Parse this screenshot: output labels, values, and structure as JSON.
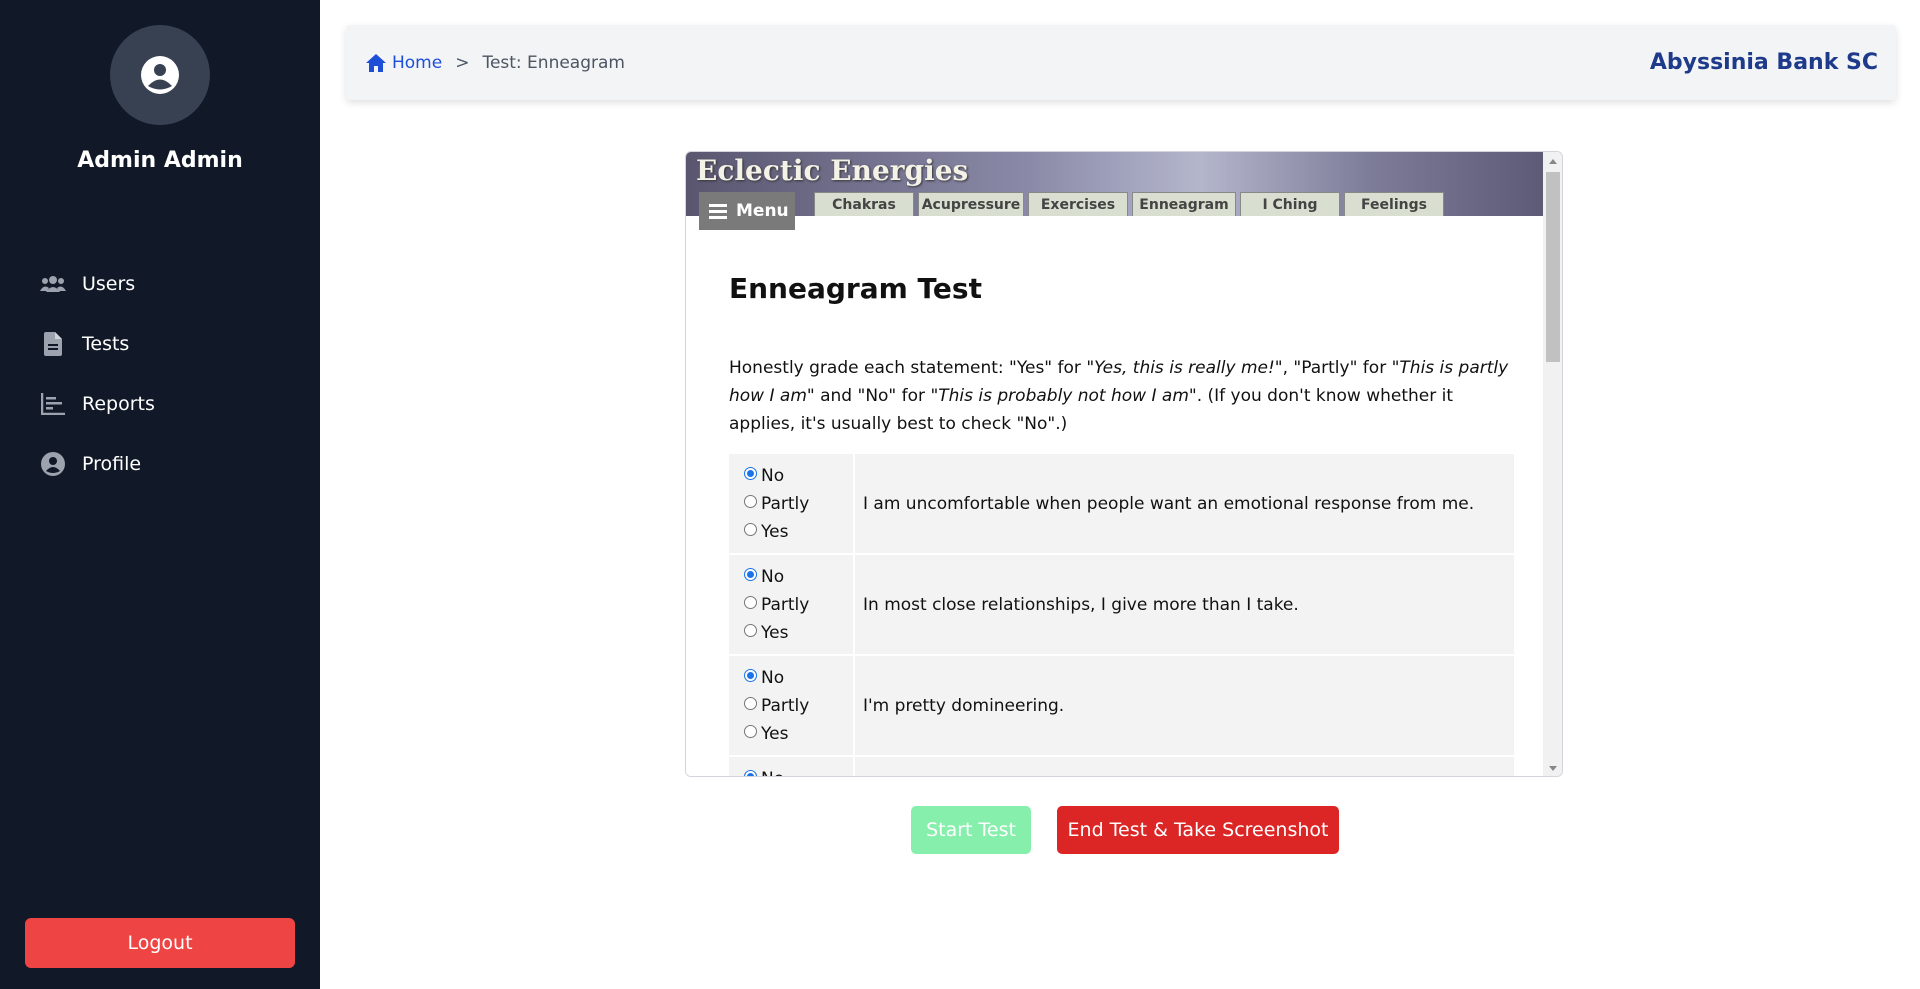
{
  "sidebar": {
    "user_name": "Admin Admin",
    "items": [
      {
        "label": "Users",
        "icon": "users-icon"
      },
      {
        "label": "Tests",
        "icon": "document-icon"
      },
      {
        "label": "Reports",
        "icon": "chart-icon"
      },
      {
        "label": "Profile",
        "icon": "user-circle-icon"
      }
    ],
    "logout_label": "Logout"
  },
  "header": {
    "breadcrumb": {
      "home": "Home",
      "separator": ">",
      "current": "Test: Enneagram"
    },
    "brand": "Abyssinia Bank SC"
  },
  "frame": {
    "site_title": "Eclectic Energies",
    "menu_label": "Menu",
    "tabs": [
      "Chakras",
      "Acupressure",
      "Exercises",
      "Enneagram",
      "I Ching",
      "Feelings"
    ],
    "heading": "Enneagram Test",
    "intro": {
      "p1": "Honestly grade each statement: \"Yes\" for ",
      "e1": "\"Yes, this is really me!\"",
      "p2": ", \"Partly\" for ",
      "e2": "\"This is partly how I am\"",
      "p3": " and \"No\" for ",
      "e3": "\"This is probably not how I am\"",
      "p4": ". (If you don't know whether it applies, it's usually best to check \"No\".)"
    },
    "options": [
      "No",
      "Partly",
      "Yes"
    ],
    "questions": [
      {
        "text": "I am uncomfortable when people want an emotional response from me.",
        "selected": "No"
      },
      {
        "text": "In most close relationships, I give more than I take.",
        "selected": "No"
      },
      {
        "text": "I'm pretty domineering.",
        "selected": "No"
      },
      {
        "text": "",
        "selected": "No"
      }
    ]
  },
  "actions": {
    "start_label": "Start Test",
    "end_label": "End Test & Take Screenshot"
  },
  "colors": {
    "sidebar_bg": "#111827",
    "logout": "#ef4444",
    "start": "#86efac",
    "end": "#dc2626",
    "brand": "#1e3a8a",
    "link": "#1d4ed8"
  }
}
